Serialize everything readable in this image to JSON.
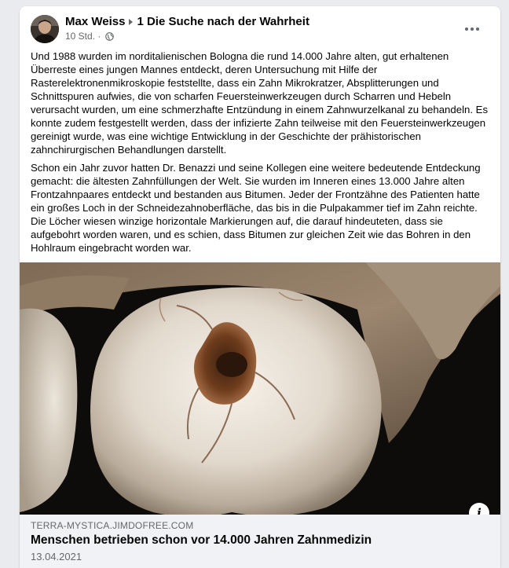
{
  "post": {
    "author": "Max Weiss",
    "group": "1 Die Suche nach der Wahrheit",
    "time": "10 Std.",
    "separator": "·",
    "paragraphs": [
      "Und 1988 wurden im norditalienischen Bologna die rund 14.000 Jahre alten, gut erhaltenen Überreste eines jungen Mannes entdeckt, deren Untersuchung mit Hilfe der Rasterelektronenmikroskopie feststellte, dass ein Zahn Mikrokratzer, Absplitterungen und Schnittspuren aufwies, die von scharfen Feuersteinwerkzeugen durch Scharren und Hebeln verursacht wurden, um eine schmerzhafte Entzündung in einem Zahnwurzelkanal zu behandeln. Es konnte zudem festgestellt werden, dass der infizierte Zahn teilweise mit den Feuersteinwerkzeugen gereinigt wurde, was eine wichtige Entwicklung in der Geschichte der prähistorischen zahnchirurgischen Behandlungen darstellt.",
      "Schon ein Jahr zuvor hatten Dr. Benazzi und seine Kollegen eine weitere bedeutende Entdeckung gemacht: die ältesten Zahnfüllungen der Welt. Sie wurden im Inneren eines 13.000 Jahre alten Frontzahnpaares entdeckt und bestanden aus Bitumen. Jeder der Frontzähne des Patienten hatte ein großes Loch in der Schneidezahnoberfläche, das bis in die Pulpakammer tief im Zahn reichte. Die Löcher wiesen winzige horizontale Markierungen auf, die darauf hindeuteten, dass sie aufgebohrt worden waren, und es schien, dass Bitumen zur gleichen Zeit wie das Bohren in den Hohlraum eingebracht worden war."
    ]
  },
  "link": {
    "domain": "TERRA-MYSTICA.JIMDOFREE.COM",
    "title": "Menschen betrieben schon vor 14.000 Jahren Zahnmedizin",
    "date": "13.04.2021",
    "info_icon": "i"
  },
  "icons": {
    "arrow": "caret-right-icon",
    "privacy": "globe-icon",
    "more": "more-horizontal-icon",
    "info": "info-icon"
  }
}
